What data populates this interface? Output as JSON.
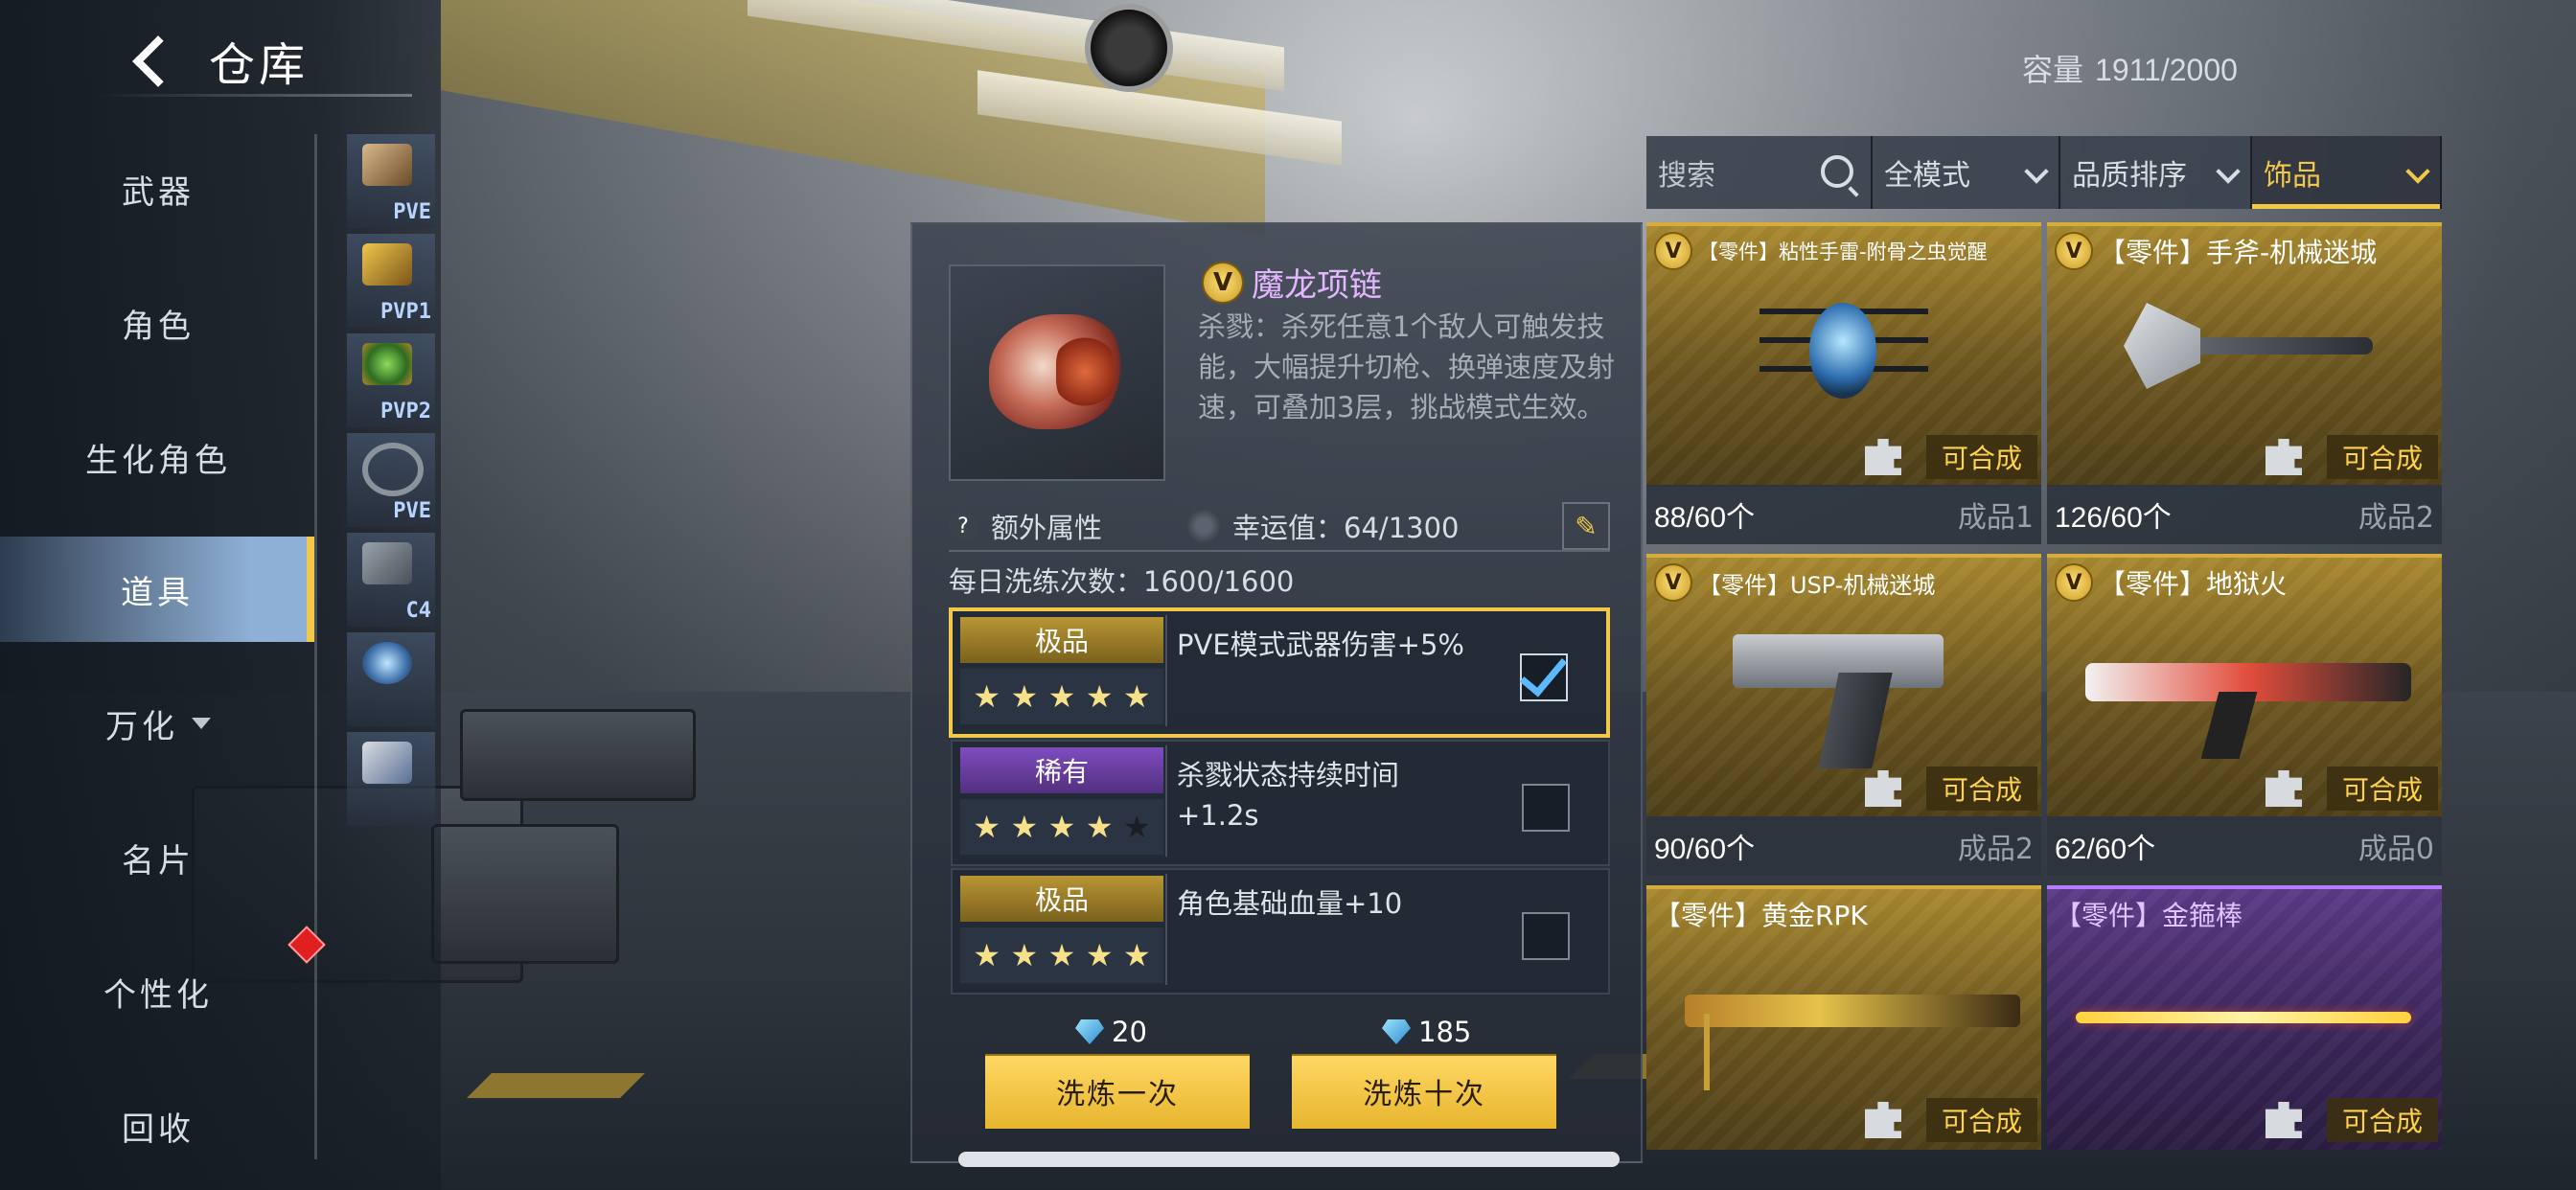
{
  "header": {
    "title": "仓库"
  },
  "capacity": {
    "label": "容量",
    "value": "1911/2000"
  },
  "nav": {
    "items": [
      {
        "label": "武器"
      },
      {
        "label": "角色"
      },
      {
        "label": "生化角色"
      },
      {
        "label": "道具",
        "active": true
      },
      {
        "label": "万化"
      },
      {
        "label": "名片"
      },
      {
        "label": "个性化"
      },
      {
        "label": "回收"
      }
    ]
  },
  "subcategories": [
    {
      "tag": "PVE"
    },
    {
      "tag": "PVP1"
    },
    {
      "tag": "PVP2"
    },
    {
      "tag": "PVE"
    },
    {
      "tag": "C4"
    },
    {
      "tag": ""
    },
    {
      "tag": ""
    }
  ],
  "detail": {
    "badge": "V",
    "name": "魔龙项链",
    "description": "杀戮：杀死任意1个敌人可触发技能，大幅提升切枪、换弹速度及射速，可叠加3层，挑战模式生效。",
    "extra_attr_label": "额外属性",
    "luck_label": "幸运值：64/1300",
    "daily_label": "每日洗练次数：1600/1600",
    "rolls": [
      {
        "rarity": "极品",
        "rarity_color": "#b99634",
        "stars": 5,
        "text": "PVE模式武器伤害+5%",
        "checked": true
      },
      {
        "rarity": "稀有",
        "rarity_color": "#7e4cc0",
        "stars": 4,
        "text": "杀戮状态持续时间+1.2s",
        "checked": false
      },
      {
        "rarity": "极品",
        "rarity_color": "#b99634",
        "stars": 5,
        "text": "角色基础血量+10",
        "checked": false
      }
    ],
    "cost_once": "20",
    "cost_ten": "185",
    "btn_once": "洗炼一次",
    "btn_ten": "洗炼十次"
  },
  "filters": {
    "search_placeholder": "搜索",
    "mode": "全模式",
    "sort": "品质排序",
    "category": "饰品"
  },
  "inventory": [
    {
      "title": "【零件】粘性手雷-附骨之虫觉醒",
      "badge": "V",
      "quality": "gold",
      "craft_label": "可合成",
      "count": "88/60个",
      "product": "成品1"
    },
    {
      "title": "【零件】手斧-机械迷城",
      "badge": "V",
      "quality": "gold",
      "craft_label": "可合成",
      "count": "126/60个",
      "product": "成品2"
    },
    {
      "title": "【零件】USP-机械迷城",
      "badge": "V",
      "quality": "gold",
      "craft_label": "可合成",
      "count": "90/60个",
      "product": "成品2"
    },
    {
      "title": "【零件】地狱火",
      "badge": "V",
      "quality": "gold",
      "craft_label": "可合成",
      "count": "62/60个",
      "product": "成品0"
    },
    {
      "title": "【零件】黄金RPK",
      "badge": "",
      "quality": "gold",
      "craft_label": "可合成"
    },
    {
      "title": "【零件】金箍棒",
      "badge": "",
      "quality": "purple",
      "craft_label": "可合成"
    }
  ],
  "colors": {
    "accent": "#f1c84a",
    "gold": "#b99634",
    "purple": "#7e4cc0"
  }
}
